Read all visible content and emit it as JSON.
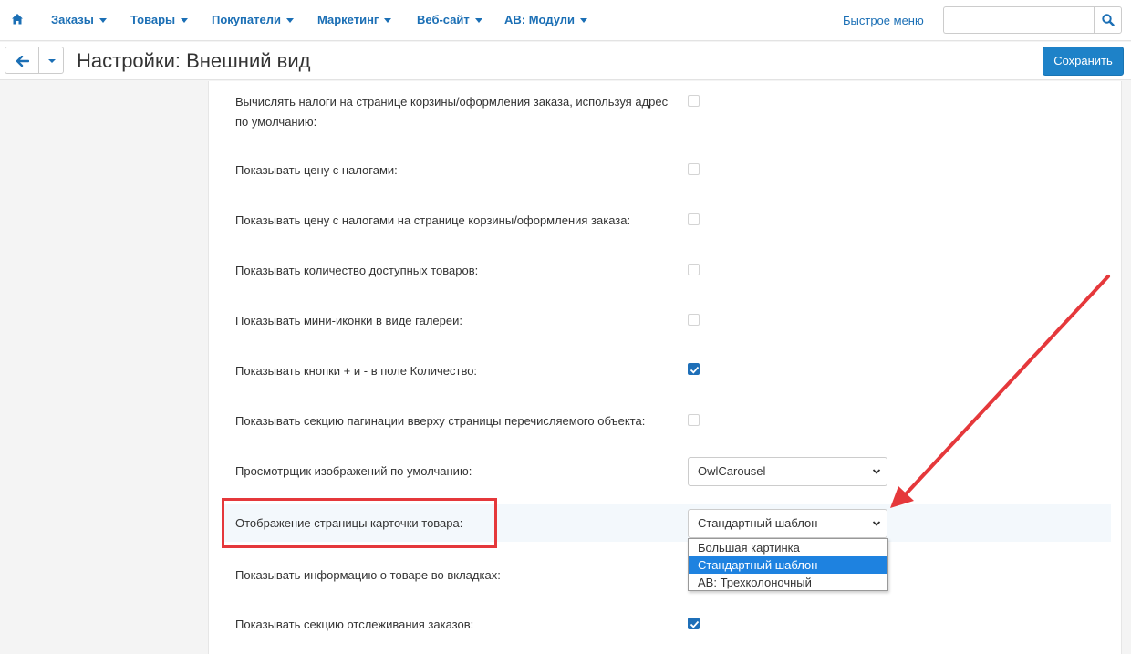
{
  "topnav": {
    "items": [
      {
        "label": "Заказы"
      },
      {
        "label": "Товары"
      },
      {
        "label": "Покупатели"
      },
      {
        "label": "Маркетинг"
      },
      {
        "label": "Веб-сайт"
      },
      {
        "label": "AB: Модули"
      }
    ],
    "quick_menu": "Быстрое меню",
    "search": {
      "value": "",
      "placeholder": ""
    }
  },
  "titlebar": {
    "title": "Настройки: Внешний вид",
    "save_label": "Сохранить"
  },
  "settings": [
    {
      "label": "Вычислять налоги на странице корзины/оформления заказа, используя адрес по умолчанию:",
      "type": "checkbox",
      "checked": false
    },
    {
      "label": "Показывать цену с налогами:",
      "type": "checkbox",
      "checked": false
    },
    {
      "label": "Показывать цену с налогами на странице корзины/оформления заказа:",
      "type": "checkbox",
      "checked": false
    },
    {
      "label": "Показывать количество доступных товаров:",
      "type": "checkbox",
      "checked": false
    },
    {
      "label": "Показывать мини-иконки в виде галереи:",
      "type": "checkbox",
      "checked": false
    },
    {
      "label": "Показывать кнопки + и - в поле Количество:",
      "type": "checkbox",
      "checked": true
    },
    {
      "label": "Показывать секцию пагинации вверху страницы перечисляемого объекта:",
      "type": "checkbox",
      "checked": false
    },
    {
      "label": "Просмотрщик изображений по умолчанию:",
      "type": "select",
      "value": "OwlCarousel"
    },
    {
      "label": "Отображение страницы карточки товара:",
      "type": "select",
      "value": "Стандартный шаблон",
      "options": [
        "Большая картинка",
        "Стандартный шаблон",
        "AB: Трехколоночный"
      ],
      "selected_index": 1
    },
    {
      "label": "Показывать информацию о товаре во вкладках:",
      "type": "checkbox",
      "checked": false
    },
    {
      "label": "Показывать секцию отслеживания заказов:",
      "type": "checkbox",
      "checked": true
    }
  ],
  "colors": {
    "accent": "#1e82c8",
    "highlight": "#e5383b",
    "link": "#1b6fb5"
  }
}
